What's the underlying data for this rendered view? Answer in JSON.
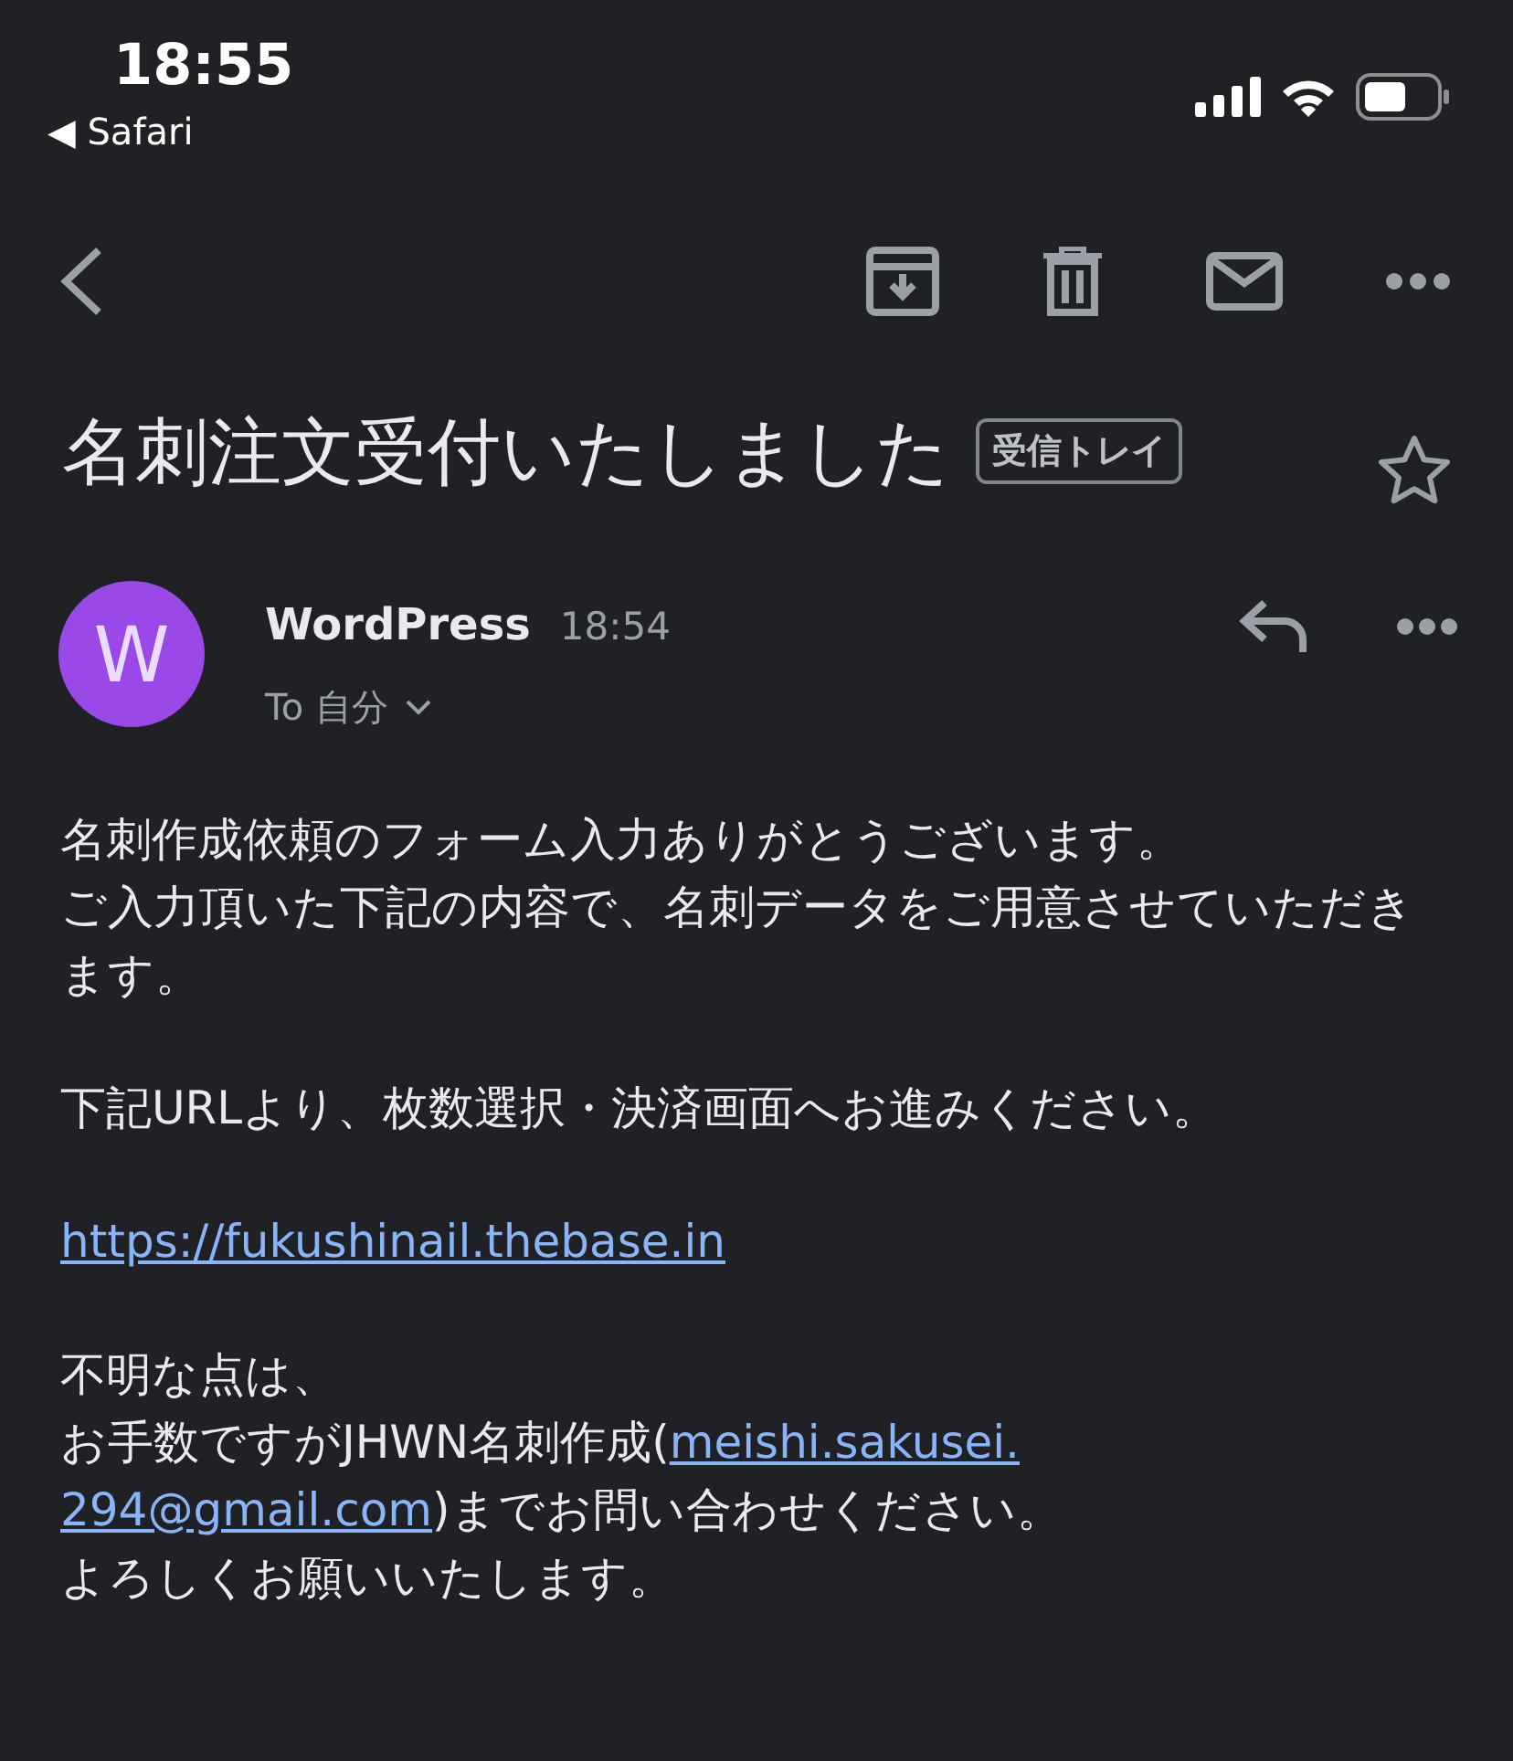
{
  "status_bar": {
    "time": "18:55",
    "back_app": "◀ Safari"
  },
  "subject": {
    "title": "名刺注文受付いたしました",
    "label": "受信トレイ",
    "starred": false
  },
  "message": {
    "avatar": "W",
    "sender": "WordPress",
    "time": "18:54",
    "recipient": "To 自分"
  },
  "body": [
    [
      [
        {
          "kind": "text",
          "text": "名刺作成依頼のフォーム入力ありがとうございます。"
        }
      ],
      [
        {
          "kind": "text",
          "text": "ご入力頂いた下記の内容で、名刺データをご用意させていただきます。"
        }
      ]
    ],
    [
      [
        {
          "kind": "text",
          "text": "下記URLより、枚数選択・決済画面へお進みください。"
        }
      ]
    ],
    [
      [
        {
          "kind": "link",
          "text": "https://fukushinail.thebase.in"
        }
      ]
    ],
    [
      [
        {
          "kind": "text",
          "text": "不明な点は、"
        }
      ],
      [
        {
          "kind": "text",
          "text": "お手数ですがJHWN名刺作成("
        },
        {
          "kind": "link",
          "text": "meishi.sakusei."
        }
      ],
      [
        {
          "kind": "link",
          "text": "294@gmail.com"
        },
        {
          "kind": "text",
          "text": ")までお問い合わせください。"
        }
      ],
      [
        {
          "kind": "text",
          "text": "よろしくお願いいたします。"
        }
      ]
    ]
  ]
}
